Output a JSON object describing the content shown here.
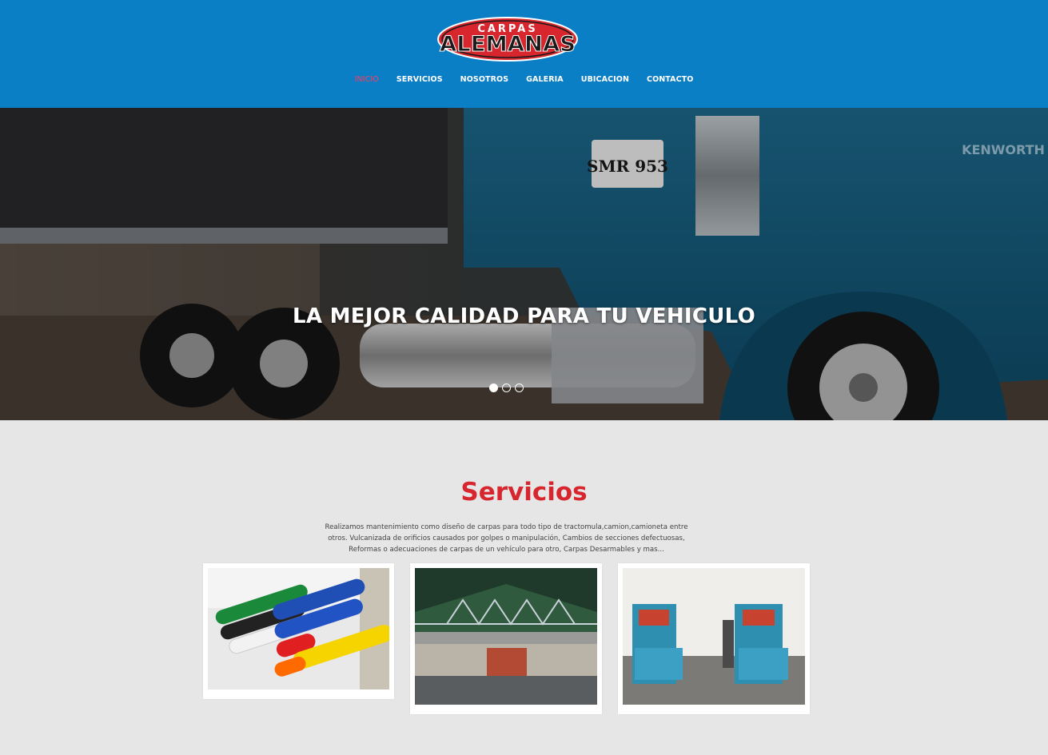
{
  "brand": {
    "logo_top": "CARPAS",
    "logo_main": "ALEMANAS",
    "colors": {
      "header": "#0b7fc6",
      "accent_red": "#d7262d",
      "nav_active": "#ff3b5c"
    }
  },
  "nav": {
    "items": [
      {
        "label": "INICIO",
        "active": true
      },
      {
        "label": "SERVICIOS",
        "active": false
      },
      {
        "label": "NOSOTROS",
        "active": false
      },
      {
        "label": "GALERIA",
        "active": false
      },
      {
        "label": "UBICACION",
        "active": false
      },
      {
        "label": "CONTACTO",
        "active": false
      }
    ]
  },
  "hero": {
    "title": "LA MEJOR CALIDAD PARA TU VEHICULO",
    "slides": 3,
    "active_slide": 1
  },
  "services": {
    "title": "Servicios",
    "description_lines": [
      "Realizamos mantenimiento como diseño de carpas para todo tipo de tractomula,camion,camioneta entre",
      "otros. Vulcanizada de orificios causados por golpes o manipulación, Cambios de secciones defectuosas,",
      "Reformas o adecuaciones de carpas de un vehículo para otro, Carpas Desarmables y mas..."
    ],
    "cards": [
      {
        "image": "tarp-fabric-rolls"
      },
      {
        "image": "carport-canopy"
      },
      {
        "image": "welding-machines"
      }
    ]
  }
}
